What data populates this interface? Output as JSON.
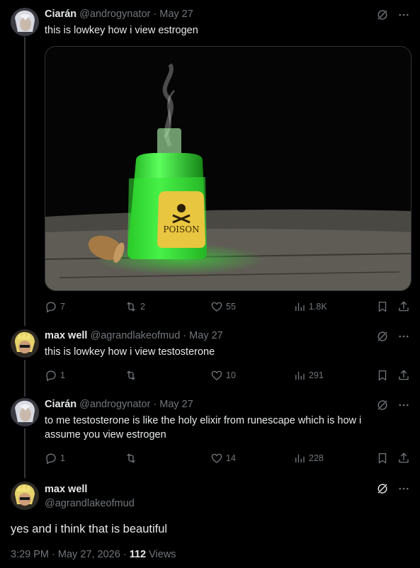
{
  "tweets": [
    {
      "name": "Ciarán",
      "handle": "@androgynator",
      "sep": "·",
      "date": "May 27",
      "text": "this is lowkey how i view estrogen",
      "media": {
        "label": "POISON",
        "description_icon": "poison-bottle-image"
      },
      "replies": "7",
      "retweets": "2",
      "likes": "55",
      "views": "1.8K"
    },
    {
      "name": "max well",
      "handle": "@agrandlakeofmud",
      "sep": "·",
      "date": "May 27",
      "text": "this is lowkey how i view testosterone",
      "replies": "1",
      "retweets": "",
      "likes": "10",
      "views": "291"
    },
    {
      "name": "Ciarán",
      "handle": "@androgynator",
      "sep": "·",
      "date": "May 27",
      "text_line1": "to me testosterone is like the holy elixir from runescape which is how i",
      "text_line2": "assume you view estrogen",
      "replies": "1",
      "retweets": "",
      "likes": "14",
      "views": "228"
    }
  ],
  "focal": {
    "name": "max well",
    "handle": "@agrandlakeofmud",
    "text": "yes and i think that is beautiful",
    "time": "3:29 PM",
    "sep": "·",
    "date": "May 27, 2026",
    "views_count": "112",
    "views_label": "Views"
  },
  "icons": [
    "grok-icon",
    "more-icon",
    "reply-icon",
    "retweet-icon",
    "like-icon",
    "views-icon",
    "bookmark-icon",
    "share-icon"
  ],
  "colors": {
    "background": "#000000",
    "text": "#e7e9ea",
    "muted": "#71767b",
    "line": "#333639"
  }
}
